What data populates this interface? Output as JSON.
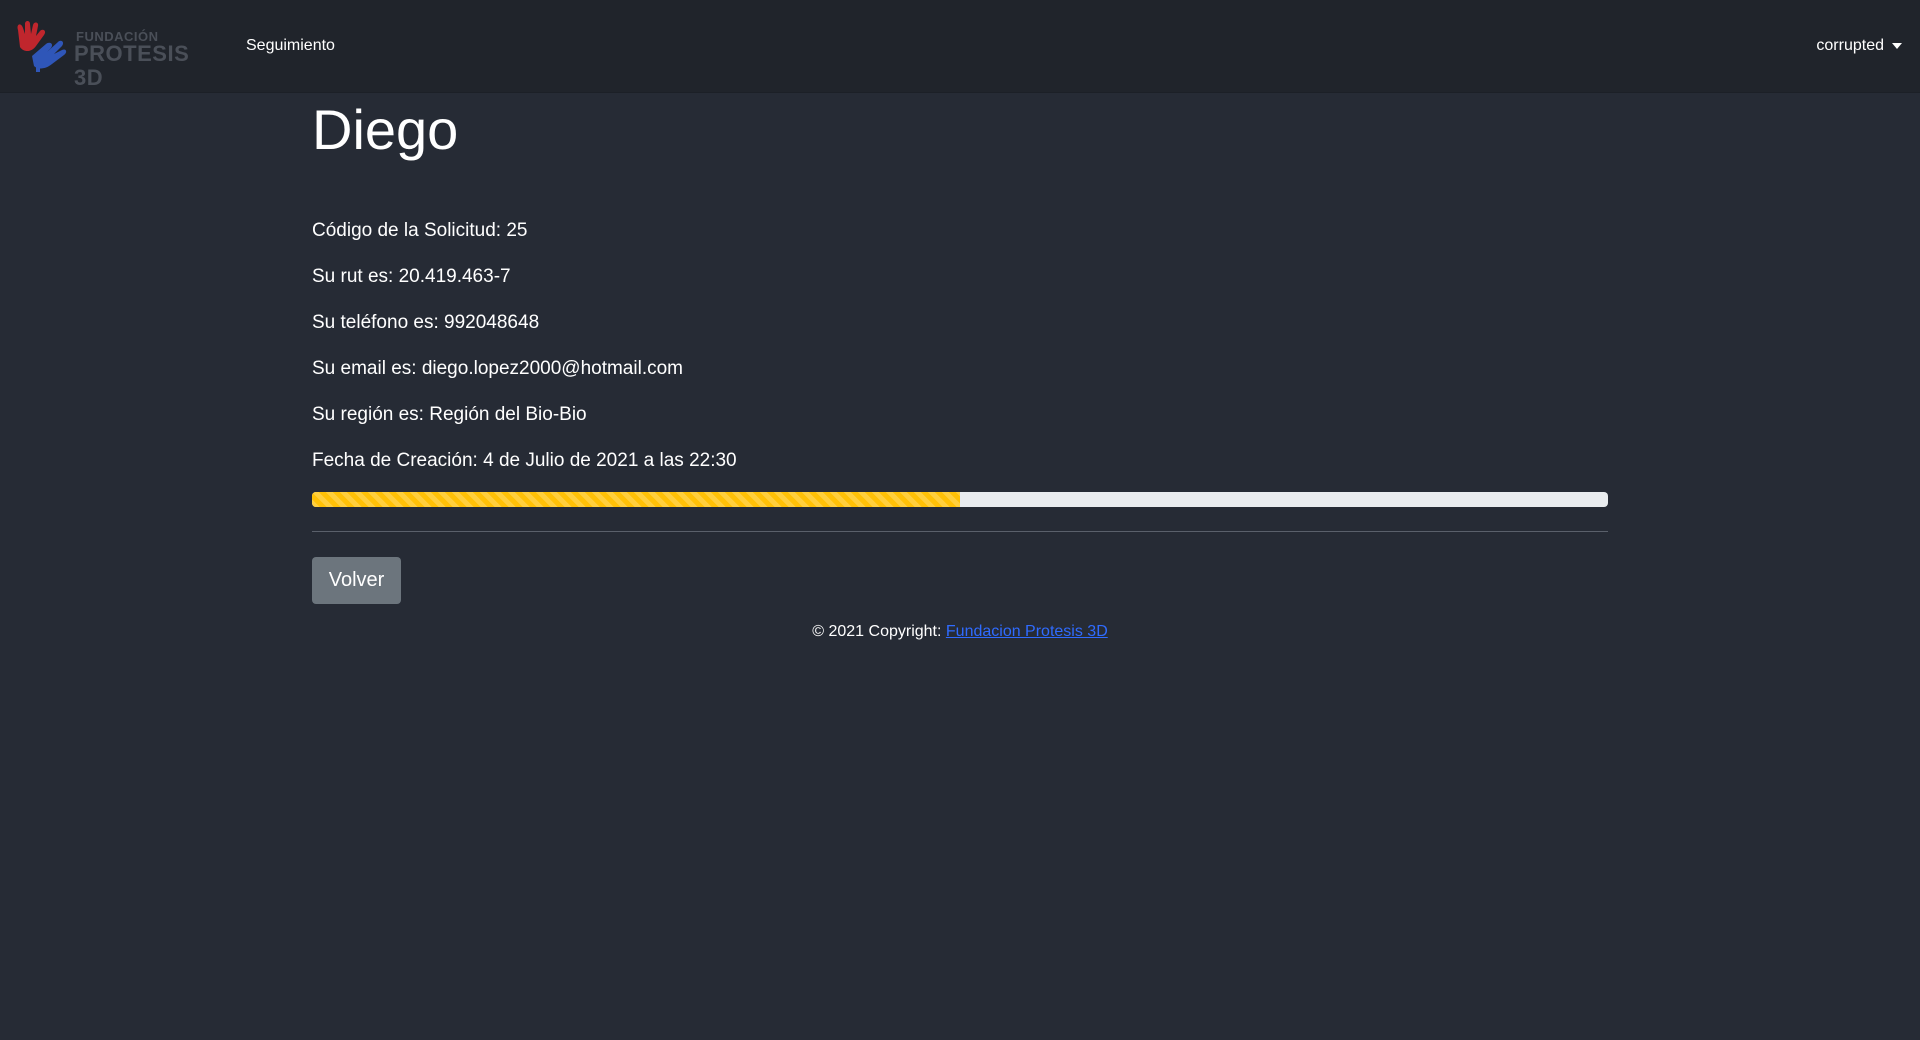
{
  "navbar": {
    "brand_top": "FUNDACIÓN",
    "brand_main": "PROTESIS 3D",
    "nav_link": "Seguimiento",
    "user": "corrupted"
  },
  "main": {
    "title": "Diego",
    "info": [
      "Código de la Solicitud: 25",
      "Su rut es: 20.419.463-7",
      "Su teléfono es: 992048648",
      "Su email es: diego.lopez2000@hotmail.com",
      "Su región es: Región del Bio-Bio",
      "Fecha de Creación: 4 de Julio de 2021 a las 22:30"
    ],
    "progress_percent": 50,
    "progress_color": "#ffc107",
    "back_button": "Volver"
  },
  "footer": {
    "prefix": "© 2021 Copyright: ",
    "link_text": "Fundacion Protesis 3D",
    "link_color": "#2f6bff"
  },
  "colors": {
    "background": "#262b35",
    "navbar": "#20242b",
    "button": "#6c757d"
  }
}
